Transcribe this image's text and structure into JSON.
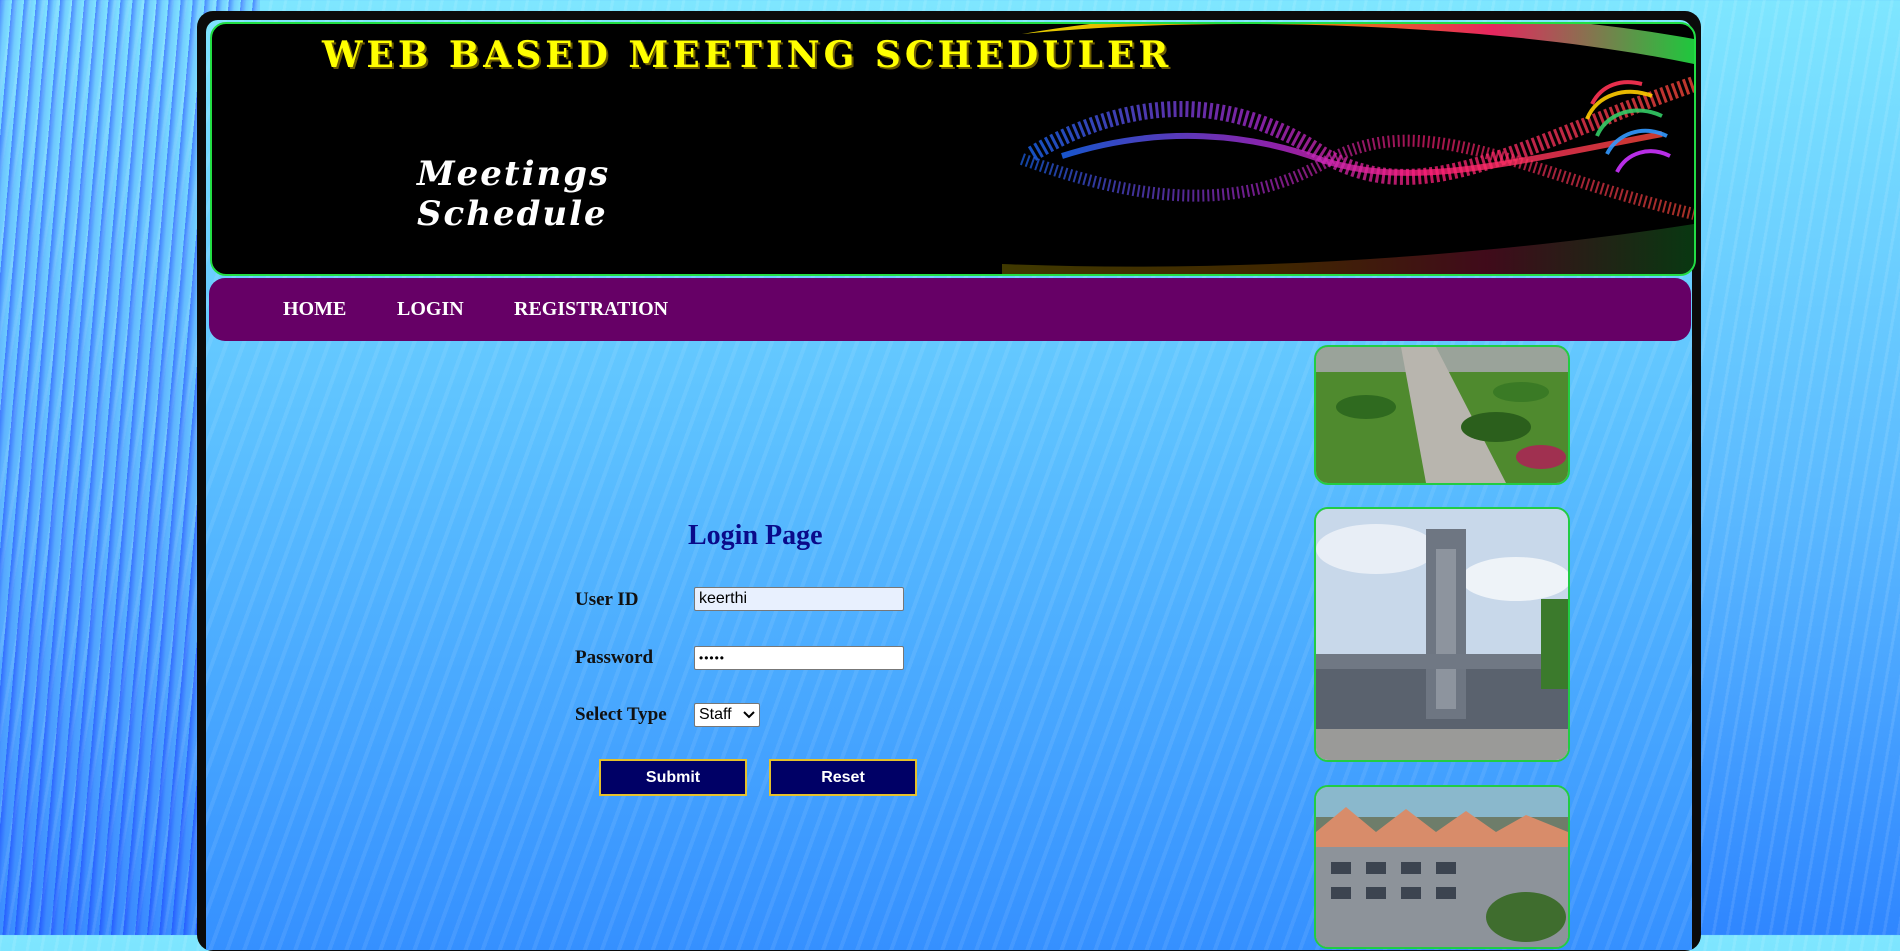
{
  "banner": {
    "title": "WEB BASED MEETING SCHEDULER",
    "subtitle_line1": "Meetings",
    "subtitle_line2": "Schedule"
  },
  "nav": {
    "items": [
      {
        "label": "HOME"
      },
      {
        "label": "LOGIN"
      },
      {
        "label": "REGISTRATION"
      }
    ]
  },
  "login": {
    "title": "Login Page",
    "user_id_label": "User ID",
    "user_id_value": "keerthi",
    "password_label": "Password",
    "password_value": "•••••",
    "type_label": "Select Type",
    "type_selected": "Staff",
    "submit_label": "Submit",
    "reset_label": "Reset"
  },
  "colors": {
    "nav_bg": "#660066",
    "banner_title": "#ffff00",
    "button_bg": "#000066",
    "button_border": "#e6c02a",
    "image_border": "#22cc44",
    "title": "#0a0a8a"
  }
}
